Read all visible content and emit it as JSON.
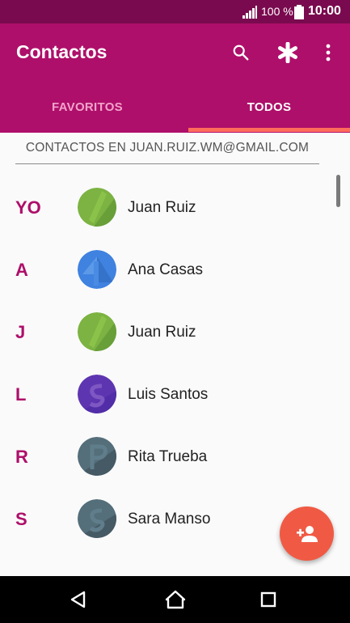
{
  "status_bar": {
    "signal_icon": "signal-icon",
    "battery_text": "100 %",
    "battery_icon": "battery-icon",
    "time": "10:00"
  },
  "app_bar": {
    "title": "Contactos",
    "search_icon": "search-icon",
    "asterisk_icon": "asterisk-icon",
    "more_icon": "more-vertical-icon",
    "color": "#ae0f6a"
  },
  "tabs": [
    {
      "label": "FAVORITOS",
      "selected": false
    },
    {
      "label": "TODOS",
      "selected": true
    }
  ],
  "account_header": "CONTACTOS EN JUAN.RUIZ.WM@GMAIL.COM",
  "contacts": [
    {
      "section": "YO",
      "name": "Juan Ruiz",
      "avatar_color": "#7cb342"
    },
    {
      "section": "A",
      "name": "Ana Casas",
      "avatar_color": "#3f82e0"
    },
    {
      "section": "J",
      "name": "Juan Ruiz",
      "avatar_color": "#7cb342"
    },
    {
      "section": "L",
      "name": "Luis Santos",
      "avatar_color": "#5e35b1"
    },
    {
      "section": "R",
      "name": "Rita Trueba",
      "avatar_color": "#546e7a"
    },
    {
      "section": "S",
      "name": "Sara Manso",
      "avatar_color": "#546e7a"
    }
  ],
  "fab": {
    "icon": "add-person-icon",
    "color": "#f05a44"
  },
  "nav_bar": {
    "back_icon": "back-triangle-icon",
    "home_icon": "home-icon",
    "recents_icon": "recents-square-icon"
  }
}
